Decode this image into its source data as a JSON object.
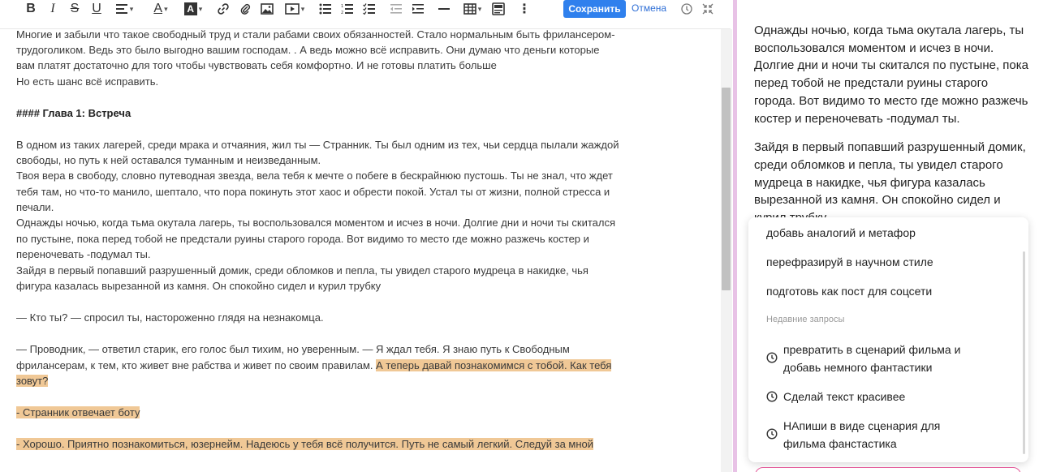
{
  "toolbar": {
    "save_label": "Сохранить",
    "cancel_label": "Отмена",
    "icons": [
      "bold-icon",
      "italic-icon",
      "strikethrough-icon",
      "underline-icon",
      "align-icon",
      "text-color-icon",
      "highlight-icon",
      "link-icon",
      "attachment-icon",
      "image-icon",
      "video-icon",
      "bullet-list-icon",
      "numbered-list-icon",
      "checklist-icon",
      "outdent-icon",
      "indent-icon",
      "horizontal-rule-icon",
      "table-icon",
      "embed-icon",
      "more-icon",
      "help-icon",
      "collapse-icon"
    ]
  },
  "editor": {
    "lines": [
      "Многие и забыли что такое свободный труд и стали рабами своих обязанностей. Стало нормальным быть фрилансером-",
      "трудоголиком. Ведь это было выгодно вашим господам. . А ведь можно всё исправить. Они думаю что деньги которые",
      "вам платят достаточно для того чтобы чувствовать себя комфортно. И не готовы платить больше",
      "Но есть шанс всё исправить.",
      "#### Глава 1: Встреча",
      "В одном из таких лагерей, среди мрака и отчаяния, жил ты — Странник. Ты был одним из тех, чьи сердца пылали жаждой",
      "свободы, но путь к ней оставался туманным и неизведанным.",
      "Твоя вера в свободу, словно путеводная звезда, вела тебя к мечте о побеге в бескрайнюю пустошь. Ты не знал, что ждет",
      "тебя там, но что-то манило, шептало, что пора покинуть этот хаос и обрести покой. Устал ты от жизни, полной стресса и",
      "печали.",
      "Однажды ночью, когда тьма окутала лагерь, ты воспользовался моментом и исчез в ночи. Долгие дни и ночи ты скитался",
      "по пустыне, пока перед тобой не предстали руины старого города. Вот видимо то место где можно разжечь костер и",
      "переночевать -подумал ты.",
      "Зайдя в первый попавший разрушенный домик, среди обломков и пепла, ты увидел старого мудреца в накидке, чья",
      "фигура казалась вырезанной из камня. Он спокойно сидел и курил трубку",
      "— Кто ты? — спросил ты, настороженно глядя на незнакомца.",
      "— Проводник, — ответил старик, его голос был тихим, но уверенным. — Я ждал тебя. Я знаю путь к Свободным",
      "фрилансерам, к тем, кто живет вне рабства и живет по своим правилам. ",
      "А теперь давай познакомимся с тобой. Как тебя",
      "зовут?",
      "- Странник отвечает боту",
      "- Хорошо. Приятно познакомиться, юзернейм. Надеюсь у тебя всё получится. Путь не самый легкий. Следуй за мной"
    ]
  },
  "preview": {
    "lines": [
      "Однажды ночью, когда тьма окутала лагерь, ты",
      "воспользовался моментом и исчез в ночи.",
      "Долгие дни и ночи ты скитался по пустыне, пока",
      "перед тобой не предстали руины старого",
      "города. Вот видимо то место где можно разжечь",
      "костер и переночевать -подумал ты.",
      "Зайдя в первый попавший разрушенный домик,",
      "среди обломков и пепла, ты увидел старого",
      "мудреца в накидке, чья фигура казалась",
      "вырезанной из камня. Он спокойно сидел и",
      "курил трубку"
    ]
  },
  "dropdown": {
    "suggestions": [
      "добавь аналогий и метафор",
      "перефразируй в научном стиле",
      "подготовь как пост для соцсети"
    ],
    "recent_title": "Недавние запросы",
    "recent": [
      {
        "line1": "превратить в сценарий фильма и",
        "line2": "добавь немного фантастики"
      },
      {
        "line1": "Сделай текст красивее",
        "line2": ""
      },
      {
        "line1": "НАпиши в виде сценария для",
        "line2": "фильма фанстастика"
      }
    ]
  },
  "colors": {
    "accent": "#2f80ed",
    "highlight": "#f0c896",
    "divider": "#e8c2e6"
  }
}
